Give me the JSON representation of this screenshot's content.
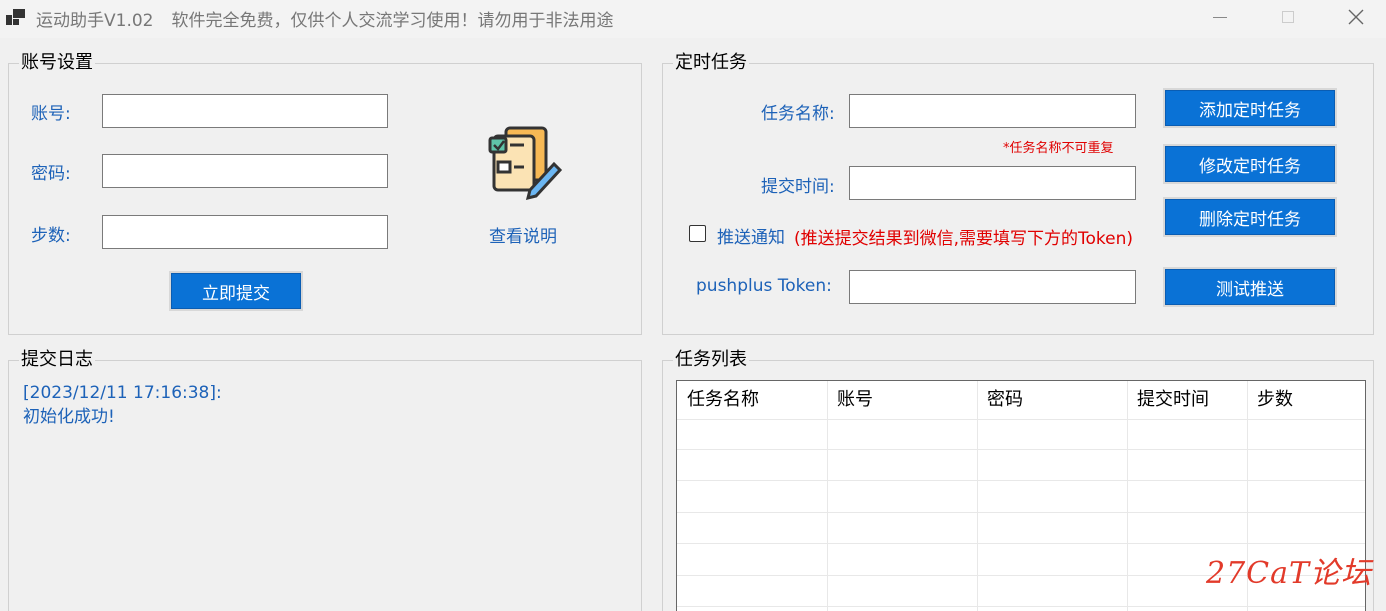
{
  "window": {
    "app_name": "运动助手V1.02",
    "notice": "软件完全免费，仅供个人交流学习使用！请勿用于非法用途"
  },
  "account": {
    "title": "账号设置",
    "account_label": "账号:",
    "password_label": "密码:",
    "steps_label": "步数:",
    "account_value": "",
    "password_value": "",
    "steps_value": "",
    "submit_label": "立即提交",
    "help_label": "查看说明"
  },
  "timer": {
    "title": "定时任务",
    "task_name_label": "任务名称:",
    "task_name_value": "",
    "task_name_hint": "*任务名称不可重复",
    "submit_time_label": "提交时间:",
    "submit_time_value": "",
    "push_label": "推送通知",
    "push_note": "(推送提交结果到微信,需要填写下方的Token)",
    "push_checked": false,
    "token_label": "pushplus Token:",
    "token_value": "",
    "add_label": "添加定时任务",
    "edit_label": "修改定时任务",
    "delete_label": "删除定时任务",
    "test_label": "测试推送"
  },
  "log": {
    "title": "提交日志",
    "lines": [
      "[2023/12/11 17:16:38]:",
      "初始化成功!"
    ]
  },
  "tasks": {
    "title": "任务列表",
    "columns": [
      "任务名称",
      "账号",
      "密码",
      "提交时间",
      "步数"
    ],
    "rows": []
  },
  "watermark": "27CaT论坛"
}
